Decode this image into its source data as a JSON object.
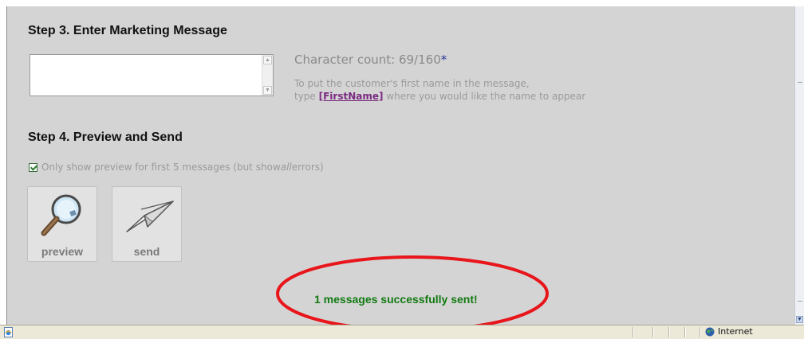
{
  "step3": {
    "heading": "Step 3. Enter Marketing Message",
    "message_value": "",
    "char_count_label": "Character count: 69/160",
    "char_count_star": "*",
    "hint_line1": "To put the customer's first name in the message,",
    "hint_line2_prefix": "type ",
    "hint_token": "[FirstName]",
    "hint_line2_suffix": " where you would like the name to appear"
  },
  "step4": {
    "heading": "Step 4. Preview and Send",
    "checkbox_checked": true,
    "checkbox_label_prefix": "Only show preview for first 5 messages (but show ",
    "checkbox_label_em": "all",
    "checkbox_label_suffix": " errors)",
    "preview_label": "preview",
    "preview_icon": "magnifying-glass-icon",
    "send_label": "send",
    "send_icon": "paper-plane-icon"
  },
  "status_message": "1 messages successfully sent!",
  "annotation": {
    "shape": "ellipse",
    "color": "#e8151b"
  },
  "statusbar": {
    "page_icon": "ie-page-icon",
    "zone_icon": "globe-icon",
    "zone_label": "Internet"
  },
  "colors": {
    "content_bg": "#d4d4d4",
    "success_text": "#117a11",
    "link_token": "#7a2a80"
  }
}
